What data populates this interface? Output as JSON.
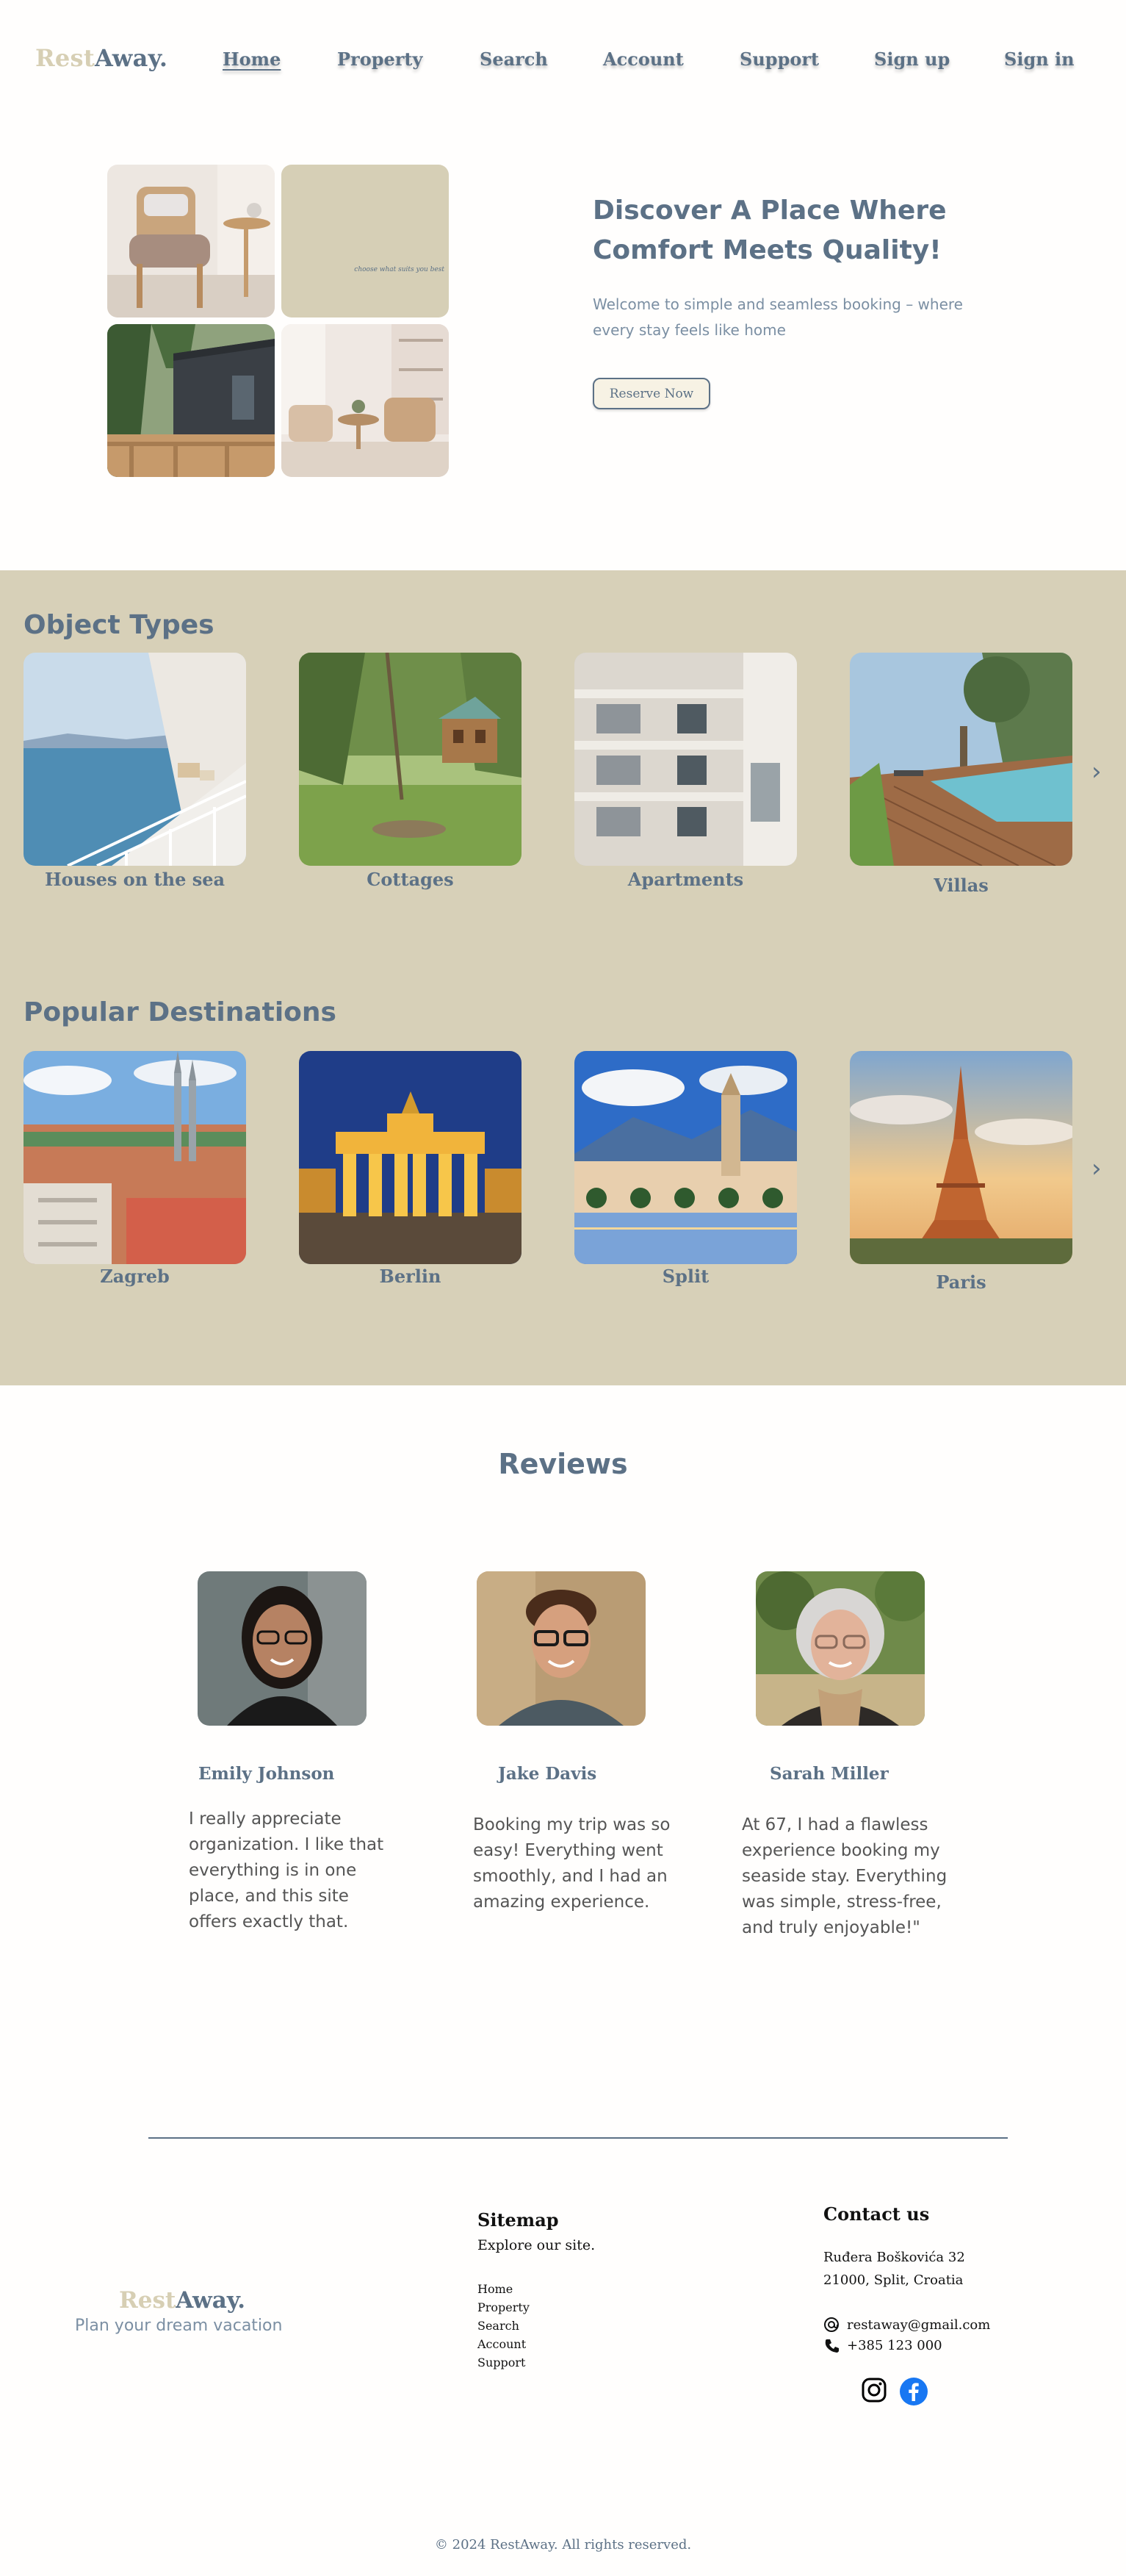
{
  "brand": {
    "part1": "Rest",
    "part2": "Away",
    "dot": "."
  },
  "nav": [
    {
      "label": "Home"
    },
    {
      "label": "Property"
    },
    {
      "label": "Search"
    },
    {
      "label": "Account"
    },
    {
      "label": "Support"
    },
    {
      "label": "Sign up"
    },
    {
      "label": "Sign in"
    }
  ],
  "hero": {
    "title": "Discover A Place Where Comfort Meets Quality!",
    "subtitle": "Welcome to simple and seamless booking – where every stay feels like home",
    "button": "Reserve Now",
    "tile_caption": "choose what suits you best"
  },
  "object_types": {
    "title": "Object Types",
    "items": [
      {
        "label": "Houses on the sea"
      },
      {
        "label": "Cottages"
      },
      {
        "label": "Apartments"
      },
      {
        "label": "Villas"
      }
    ]
  },
  "destinations": {
    "title": "Popular Destinations",
    "items": [
      {
        "label": "Zagreb"
      },
      {
        "label": "Berlin"
      },
      {
        "label": "Split"
      },
      {
        "label": "Paris"
      }
    ]
  },
  "reviews": {
    "title": "Reviews",
    "items": [
      {
        "name": "Emily Johnson",
        "text": "I really appreciate organization. I like that everything is in one place, and this site offers exactly that."
      },
      {
        "name": "Jake Davis",
        "text": "Booking my trip was so easy! Everything went smoothly, and I had an amazing experience."
      },
      {
        "name": "Sarah Miller",
        "text": "At 67, I had a flawless experience booking my seaside stay. Everything was simple, stress-free, and truly enjoyable!\""
      }
    ]
  },
  "footer": {
    "tagline": "Plan your dream vacation",
    "sitemap_title": "Sitemap",
    "sitemap_sub": "Explore our site.",
    "sitemap_links": [
      "Home",
      "Property",
      "Search",
      "Account",
      "Support"
    ],
    "contact_title": "Contact us",
    "address_line1": "Ruđera Boškovića 32",
    "address_line2": "21000, Split, Croatia",
    "email": "restaway@gmail.com",
    "phone": "+385 123 000",
    "copyright": "© 2024 RestAway.  All rights reserved."
  }
}
